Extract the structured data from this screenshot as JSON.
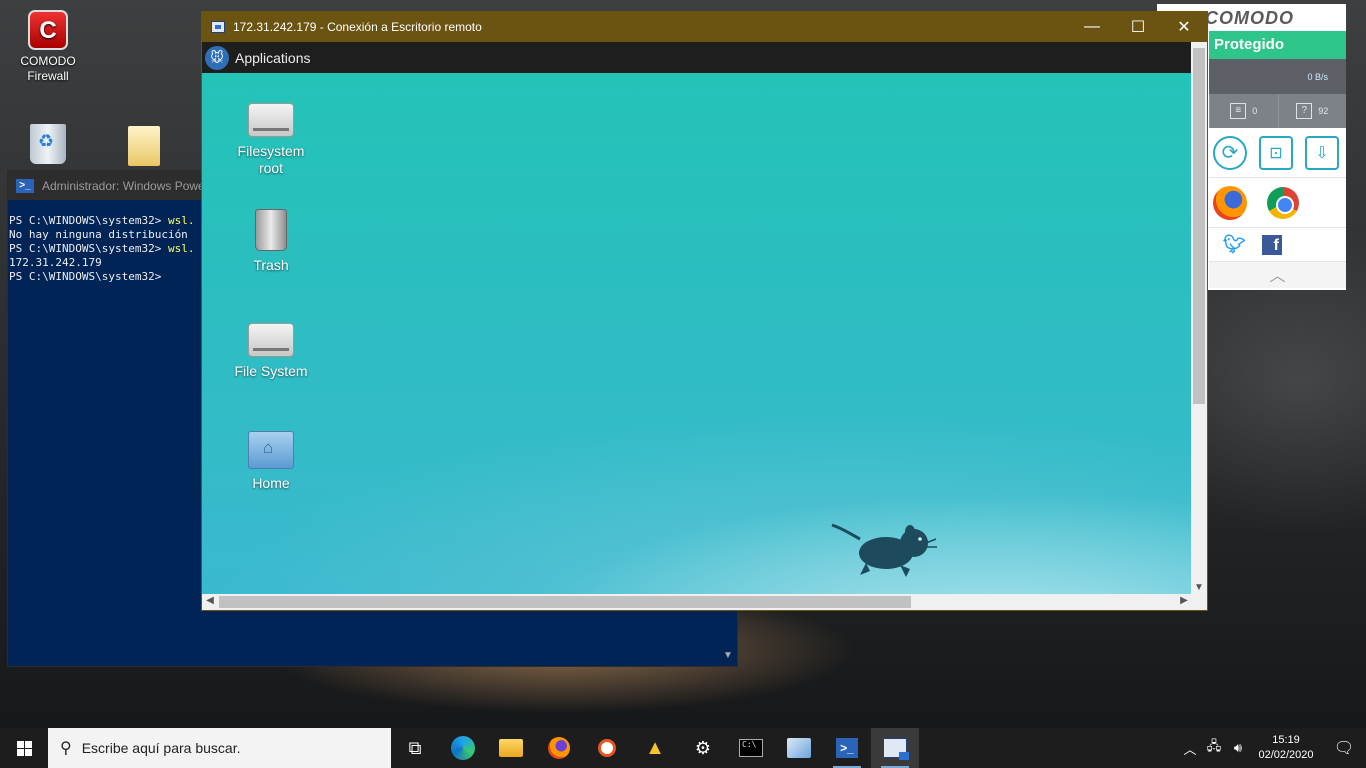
{
  "desktop": {
    "icons": [
      {
        "label_line1": "COMODO",
        "label_line2": "Firewall",
        "icon": "comodo-firewall-icon"
      },
      {
        "label": "",
        "icon": "recycle-bin-icon"
      },
      {
        "label": "",
        "icon": "file-shortcut-icon"
      }
    ]
  },
  "powershell": {
    "title": "Administrador: Windows Powe",
    "lines": [
      {
        "prompt": "PS C:\\WINDOWS\\system32> ",
        "cmd": "wsl."
      },
      {
        "text": "No hay ninguna distribución"
      },
      {
        "prompt": "PS C:\\WINDOWS\\system32> ",
        "cmd": "wsl."
      },
      {
        "text": "172.31.242.179"
      },
      {
        "prompt": "PS C:\\WINDOWS\\system32>",
        "cmd": ""
      }
    ]
  },
  "comodo": {
    "brand": "COMODO",
    "status": "Protegido",
    "speed": "0 B/s",
    "count_tasks": "0",
    "count_unknown": "92",
    "accent": "#2ec58a"
  },
  "rdp": {
    "title": "172.31.242.179 - Conexión a Escritorio remoto",
    "minimize": "—",
    "maximize": "☐",
    "close": "✕",
    "panel": {
      "menu_label": "Applications"
    },
    "icons": [
      {
        "line1": "Filesystem",
        "line2": "root",
        "icon": "usb-drive-icon"
      },
      {
        "line1": "Trash",
        "line2": "",
        "icon": "trash-icon"
      },
      {
        "line1": "File System",
        "line2": "",
        "icon": "hard-drive-icon"
      },
      {
        "line1": "Home",
        "line2": "",
        "icon": "home-folder-icon"
      }
    ]
  },
  "taskbar": {
    "search_placeholder": "Escribe aquí para buscar.",
    "time": "15:19",
    "date": "02/02/2020"
  }
}
